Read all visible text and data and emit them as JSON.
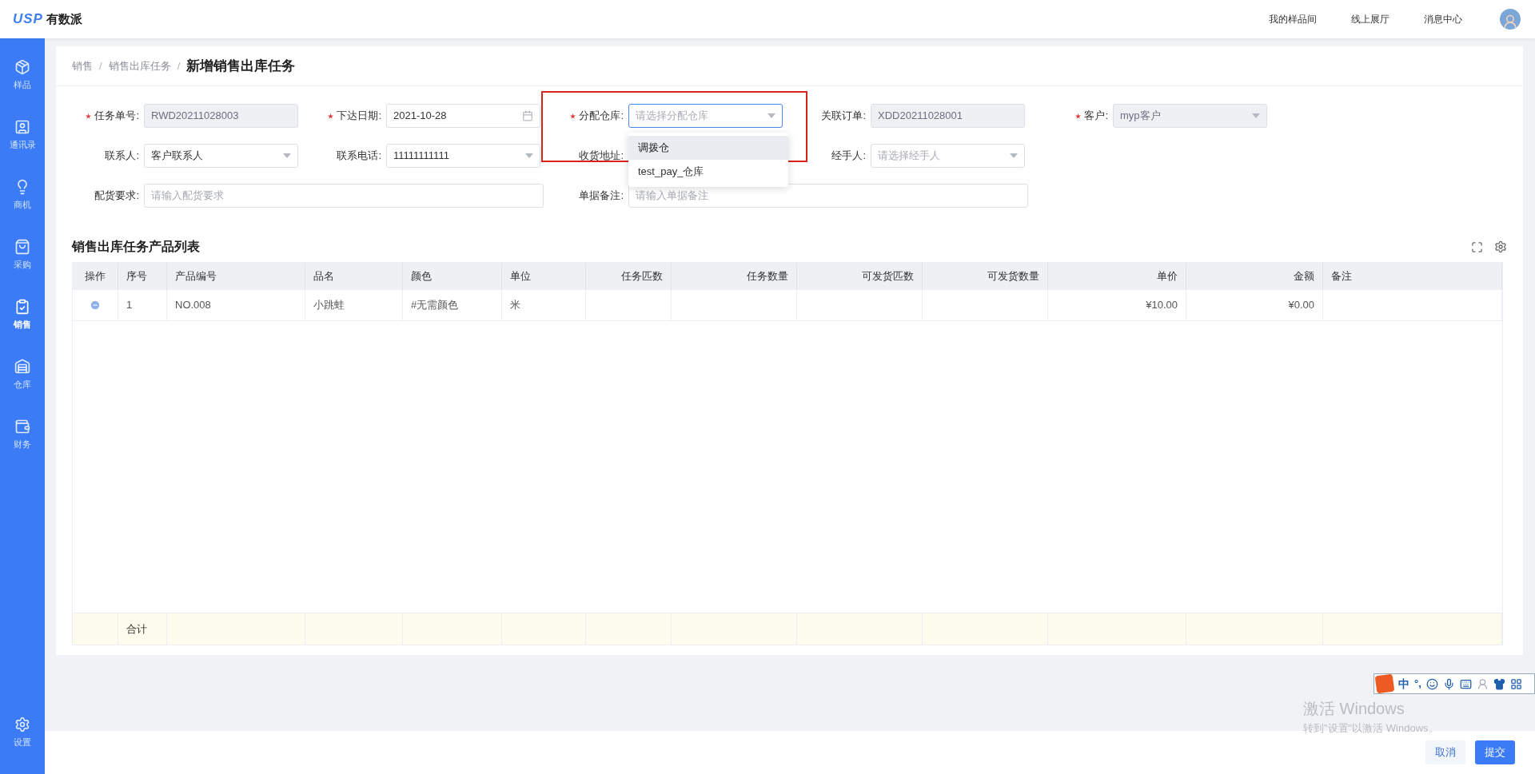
{
  "header": {
    "logo": "USP",
    "brand": "有数派",
    "links": [
      "我的样品间",
      "线上展厅",
      "消息中心"
    ]
  },
  "sidebar": {
    "items": [
      {
        "label": "样品",
        "selected": false
      },
      {
        "label": "通讯录",
        "selected": false
      },
      {
        "label": "商机",
        "selected": false
      },
      {
        "label": "采购",
        "selected": false
      },
      {
        "label": "销售",
        "selected": true
      },
      {
        "label": "仓库",
        "selected": false
      },
      {
        "label": "财务",
        "selected": false
      }
    ],
    "footer_item": {
      "label": "设置"
    }
  },
  "breadcrumb": {
    "items": [
      "销售",
      "销售出库任务"
    ],
    "separator": "/",
    "current": "新增销售出库任务"
  },
  "form": {
    "fields": [
      {
        "label": "任务单号:",
        "required": true,
        "kind": "text",
        "value": "RWD20211028003",
        "disabled": true
      },
      {
        "label": "下达日期:",
        "required": true,
        "kind": "date",
        "value": "2021-10-28",
        "disabled": false
      },
      {
        "label": "分配仓库:",
        "required": true,
        "kind": "select",
        "placeholder": "请选择分配仓库",
        "disabled": false,
        "focused": true,
        "highlight": true,
        "options": [
          {
            "label": "调拨仓",
            "highlighted": true
          },
          {
            "label": "test_pay_仓库",
            "highlighted": false
          }
        ]
      },
      {
        "label": "关联订单:",
        "kind": "text",
        "value": "XDD20211028001",
        "disabled": true
      },
      {
        "label": "客户:",
        "required": true,
        "kind": "select",
        "value": "myp客户",
        "disabled": true
      },
      {
        "label": "联系人:",
        "kind": "select",
        "value": "客户联系人",
        "disabled": false
      },
      {
        "label": "联系电话:",
        "kind": "select",
        "value": "11111111111",
        "disabled": false
      },
      {
        "label": "收货地址:",
        "kind": "hidden"
      },
      {
        "label": "经手人:",
        "kind": "select",
        "placeholder": "请选择经手人",
        "disabled": false
      },
      {
        "label": "配货要求:",
        "kind": "text",
        "placeholder": "请输入配货要求",
        "disabled": false
      },
      {
        "label": "单据备注:",
        "kind": "text",
        "placeholder": "请输入单据备注",
        "disabled": false
      }
    ]
  },
  "table": {
    "title": "销售出库任务产品列表",
    "columns": [
      "操作",
      "序号",
      "产品编号",
      "品名",
      "颜色",
      "单位",
      "任务匹数",
      "任务数量",
      "可发货匹数",
      "可发货数量",
      "单价",
      "金额",
      "备注"
    ],
    "rows": [
      {
        "cells": [
          "",
          "1",
          "NO.008",
          "小跳蛙",
          "#无需颜色",
          "米",
          "",
          "",
          "",
          "",
          "¥10.00",
          "¥0.00",
          ""
        ]
      }
    ],
    "total_row": {
      "label": "合计"
    }
  },
  "footer": {
    "buttons": [
      {
        "label": "取消",
        "kind": "secondary"
      },
      {
        "label": "提交",
        "kind": "primary"
      }
    ]
  },
  "ime_toolbar": {
    "mode": "中",
    "punct": "°,"
  },
  "os_notice": {
    "title": "激活 Windows",
    "subtitle": "转到\"设置\"以激活 Windows。"
  }
}
